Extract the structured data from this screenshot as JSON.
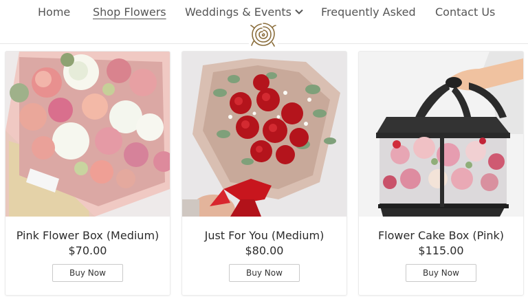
{
  "nav": {
    "items": [
      {
        "label": "Home"
      },
      {
        "label": "Shop Flowers"
      },
      {
        "label": "Weddings & Events"
      },
      {
        "label": "Frequently Asked"
      },
      {
        "label": "Contact Us"
      }
    ],
    "active": "Shop Flowers"
  },
  "logo": {
    "icon": "rose-icon",
    "color": "#8a6d3b"
  },
  "products": [
    {
      "title": "Pink Flower Box (Medium)",
      "price": "$70.00",
      "button": "Buy Now",
      "image": "pink-flower-box-photo"
    },
    {
      "title": "Just For You (Medium)",
      "price": "$80.00",
      "button": "Buy Now",
      "image": "red-rose-bouquet-photo"
    },
    {
      "title": "Flower Cake Box (Pink)",
      "price": "$115.00",
      "button": "Buy Now",
      "image": "flower-cake-box-photo"
    }
  ],
  "colors": {
    "accent_gold": "#8a6d3b",
    "text": "#2b2b2b",
    "nav_text": "#555555"
  }
}
